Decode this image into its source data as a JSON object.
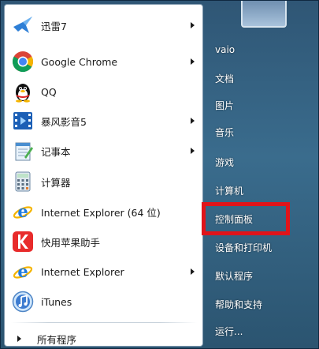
{
  "left_panel": {
    "items": [
      {
        "label": "迅雷7",
        "icon": "thunder-bird-icon",
        "has_submenu": true
      },
      {
        "label": "Google Chrome",
        "icon": "chrome-icon",
        "has_submenu": true
      },
      {
        "label": "QQ",
        "icon": "qq-penguin-icon",
        "has_submenu": false
      },
      {
        "label": "暴风影音5",
        "icon": "baofeng-film-icon",
        "has_submenu": true
      },
      {
        "label": "记事本",
        "icon": "notepad-icon",
        "has_submenu": true
      },
      {
        "label": "计算器",
        "icon": "calculator-icon",
        "has_submenu": false
      },
      {
        "label": "Internet Explorer (64 位)",
        "icon": "ie-icon",
        "has_submenu": false
      },
      {
        "label": "快用苹果助手",
        "icon": "kuaiyong-icon",
        "has_submenu": false
      },
      {
        "label": "Internet Explorer",
        "icon": "ie-icon",
        "has_submenu": true
      },
      {
        "label": "iTunes",
        "icon": "itunes-icon",
        "has_submenu": false
      }
    ],
    "all_programs": "所有程序"
  },
  "right_panel": {
    "items": [
      {
        "label": "vaio"
      },
      {
        "label": "文档"
      },
      {
        "label": "图片"
      },
      {
        "label": "音乐"
      },
      {
        "label": "游戏"
      },
      {
        "label": "计算机"
      },
      {
        "label": "控制面板"
      },
      {
        "label": "设备和打印机"
      },
      {
        "label": "默认程序"
      },
      {
        "label": "帮助和支持"
      },
      {
        "label": "运行..."
      }
    ]
  },
  "colors": {
    "highlight": "#e0141a",
    "menu_background": "#2f5675"
  }
}
